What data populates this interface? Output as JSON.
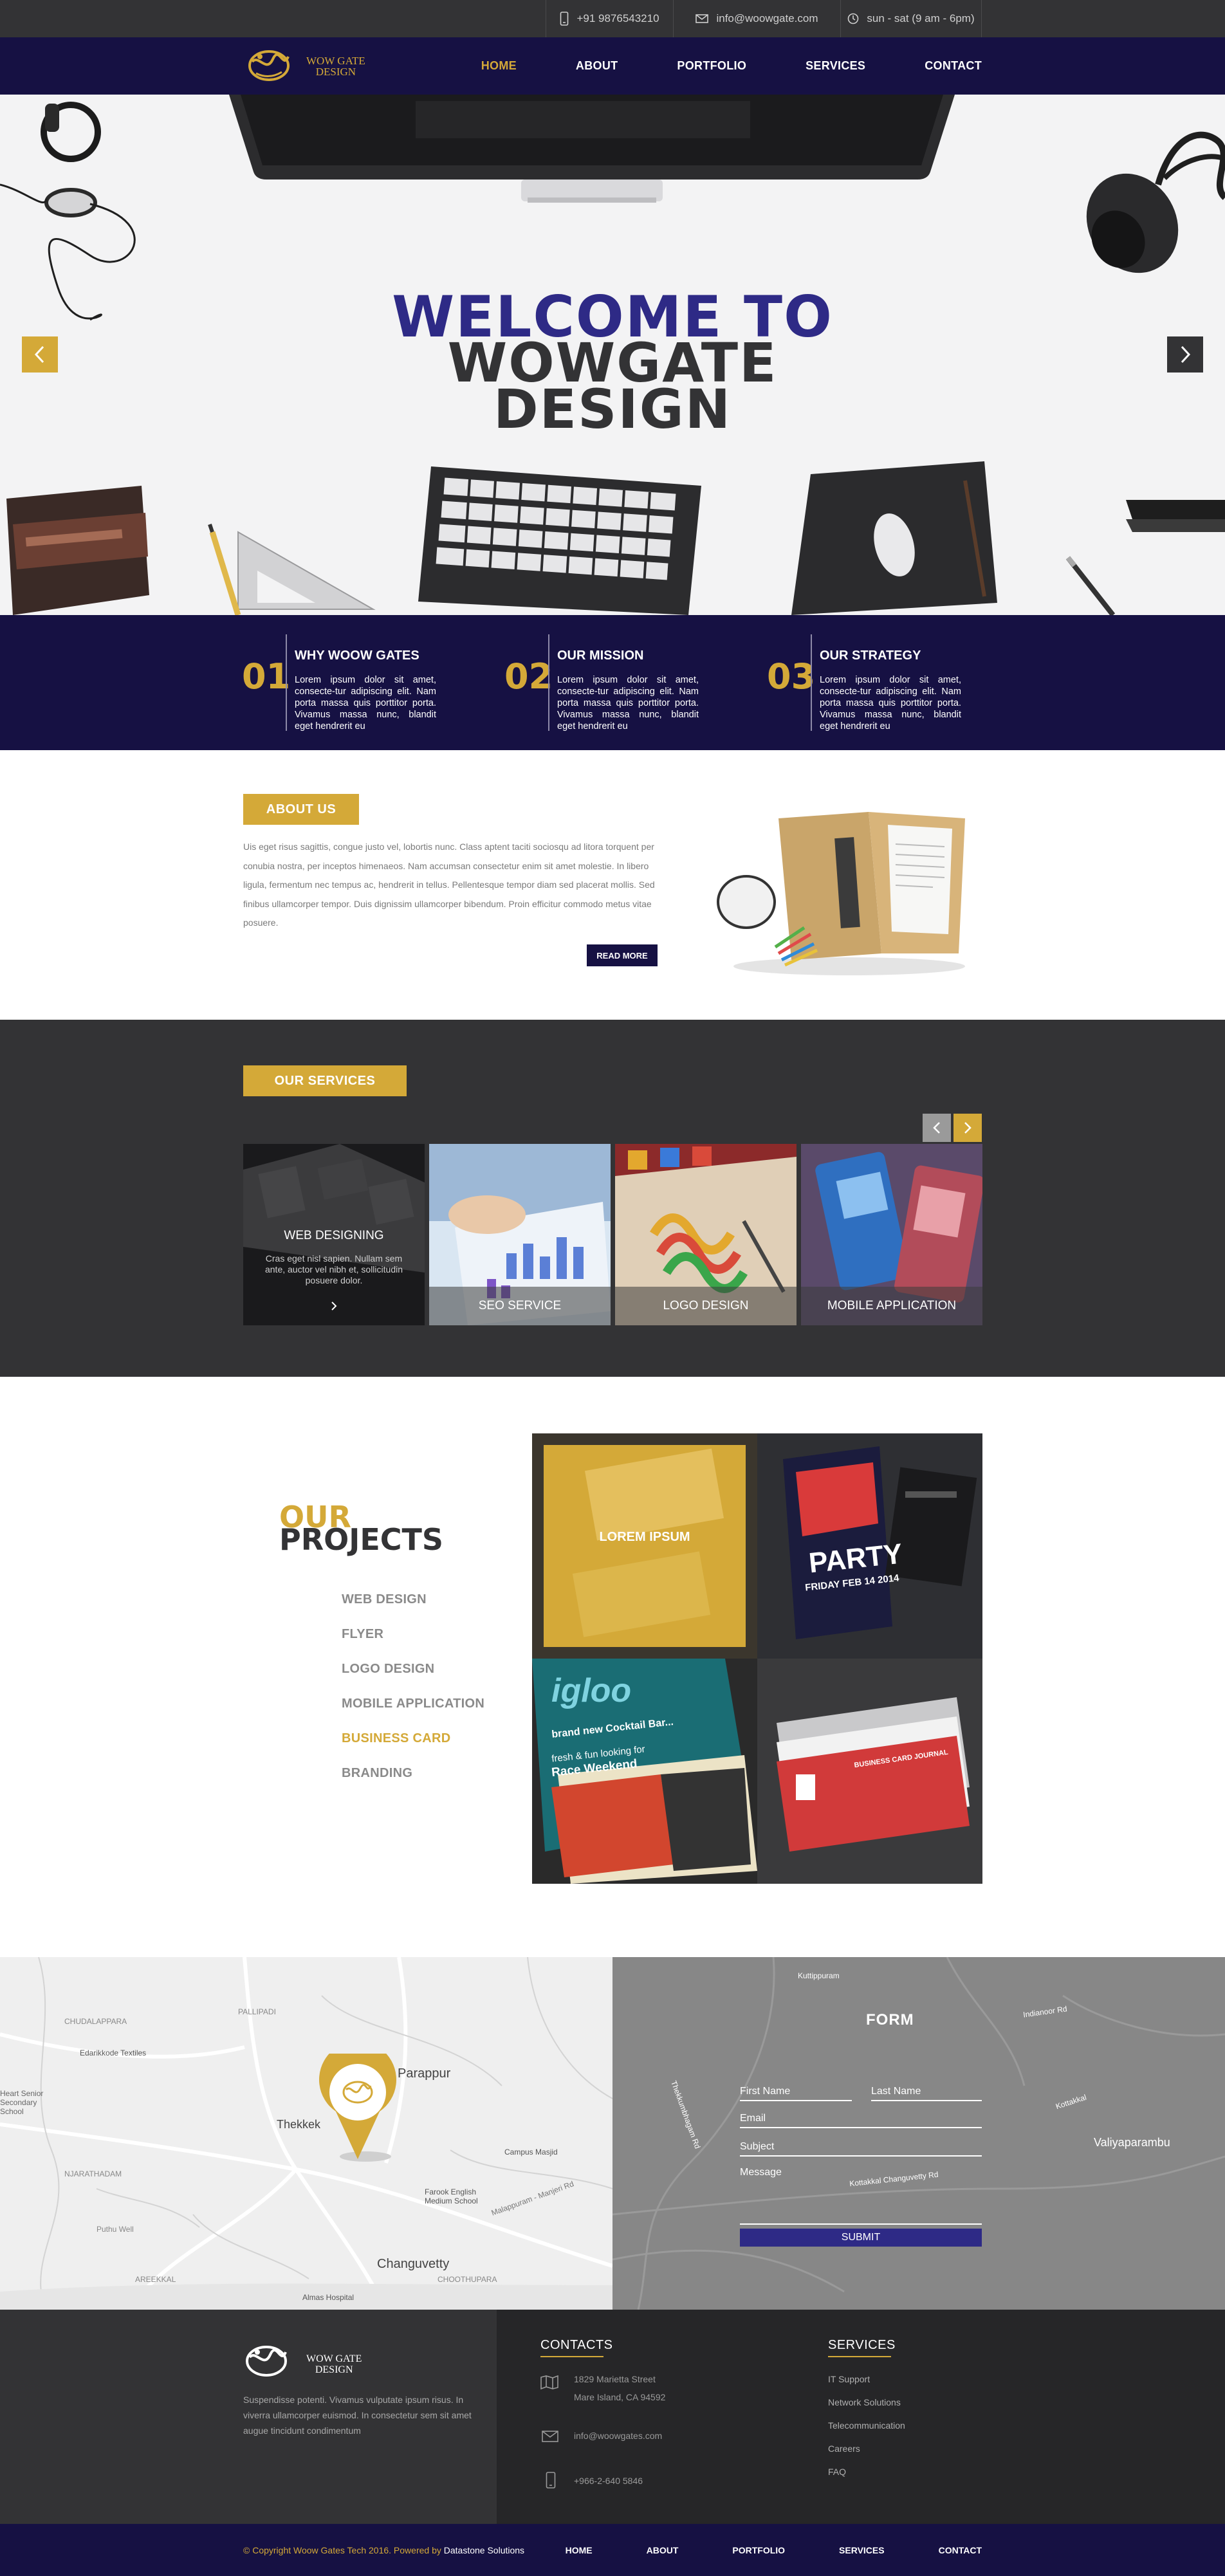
{
  "topbar": {
    "phone": "+91 9876543210",
    "email": "info@woowgate.com",
    "hours": "sun - sat (9 am - 6pm)"
  },
  "brand": {
    "line1": "WOW GATE",
    "line2": "DESIGN"
  },
  "nav": {
    "items": [
      {
        "label": "HOME",
        "active": true
      },
      {
        "label": "ABOUT",
        "active": false
      },
      {
        "label": "PORTFOLIO",
        "active": false
      },
      {
        "label": "SERVICES",
        "active": false
      },
      {
        "label": "CONTACT",
        "active": false
      }
    ]
  },
  "hero": {
    "line1": "WELCOME TO",
    "line2": "WOWGATE",
    "line3": "DESIGN"
  },
  "features": [
    {
      "num": "01",
      "title": "WHY WOOW GATES",
      "text": "Lorem ipsum dolor sit amet, consecte-tur adipiscing elit. Nam porta massa quis porttitor porta. Vivamus massa nunc, blandit eget hendrerit eu"
    },
    {
      "num": "02",
      "title": "OUR MISSION",
      "text": "Lorem ipsum dolor sit amet, consecte-tur adipiscing elit. Nam porta massa quis porttitor porta. Vivamus massa nunc, blandit eget hendrerit eu"
    },
    {
      "num": "03",
      "title": "OUR STRATEGY",
      "text": "Lorem ipsum dolor sit amet, consecte-tur adipiscing elit. Nam porta massa quis porttitor porta. Vivamus massa nunc, blandit eget hendrerit eu"
    }
  ],
  "about": {
    "badge": "ABOUT US",
    "text": "Uis eget risus sagittis, congue justo vel, lobortis nunc. Class aptent taciti sociosqu ad litora torquent per conubia nostra, per inceptos himenaeos. Nam accumsan consectetur enim sit amet molestie. In libero ligula, fermentum nec tempus ac, hendrerit in tellus. Pellentesque tempor diam sed placerat mollis. Sed finibus ullamcorper tempor. Duis dignissim ullamcorper bibendum. Proin efficitur commodo metus vitae posuere.",
    "button": "READ MORE"
  },
  "services": {
    "badge": "OUR SERVICES",
    "items": [
      {
        "title": "WEB DESIGNING",
        "text": "Cras eget nisl sapien. Nullam sem ante, auctor vel nibh et, sollicitudin posuere dolor."
      },
      {
        "title": "SEO SERVICE"
      },
      {
        "title": "LOGO DESIGN"
      },
      {
        "title": "MOBILE APPLICATION"
      }
    ]
  },
  "projects": {
    "title1": "OUR",
    "title2": "PROJECTS",
    "menu": [
      {
        "label": "WEB DESIGN",
        "active": false
      },
      {
        "label": "FLYER",
        "active": false
      },
      {
        "label": "LOGO DESIGN",
        "active": false
      },
      {
        "label": "MOBILE APPLICATION",
        "active": false
      },
      {
        "label": "BUSINESS CARD",
        "active": true
      },
      {
        "label": "BRANDING",
        "active": false
      }
    ],
    "tile_caption": "LOREM IPSUM",
    "flyer": {
      "top": "PARTY",
      "date": "FRIDAY FEB 14 2014"
    },
    "igloo": {
      "brand": "igloo",
      "line1": "brand new Cocktail Bar...",
      "line2": "fresh & fun looking for",
      "line3": "Race Weekend"
    },
    "card_title": "BUSINESS CARD JOURNAL"
  },
  "map": {
    "places": [
      "CHUDALAPPARA",
      "PALLIPADI",
      "Edarikkode Textiles",
      "Heart Senior Secondary School",
      "NJARATHADAM",
      "Parappur",
      "Thekkek",
      "Campus Masjid",
      "Farook English Medium School",
      "Puthu Well",
      "AREEKKAL",
      "Changuvetty",
      "CHOOTHUPARA",
      "Almas Hospital",
      "Kottakkal Changuvetty Rd",
      "Valiyaparambu",
      "Indianoor Rd",
      "Kuttippuram",
      "Kottakkal",
      "Thekkumbhagam Rd",
      "Malappuram - Manjeri Rd"
    ]
  },
  "form": {
    "title": "FORM",
    "first_name": "First Name",
    "last_name": "Last Name",
    "email": "Email",
    "subject": "Subject",
    "message": "Message",
    "submit": "SUBMIT"
  },
  "footer": {
    "about": "Suspendisse potenti. Vivamus vulputate ipsum risus. In viverra ullamcorper euismod. In consectetur sem sit amet augue tincidunt condimentum",
    "contacts_title": "CONTACTS",
    "address1": "1829 Marietta Street",
    "address2": "Mare Island, CA 94592",
    "email": "info@woowgates.com",
    "phone": "+966-2-640 5846",
    "services_title": "SERVICES",
    "services": [
      "IT Support",
      "Network Solutions",
      "Telecommunication",
      "Careers",
      "FAQ"
    ]
  },
  "bottom": {
    "copyright": "© Copyright Woow Gates Tech 2016.  Powered by ",
    "powered": "Datastone Solutions",
    "links": [
      "HOME",
      "ABOUT",
      "PORTFOLIO",
      "SERVICES",
      "CONTACT"
    ]
  },
  "colors": {
    "navy": "#161143",
    "gold": "#d4a938",
    "dark": "#333335",
    "heroBlue": "#2e2a86"
  }
}
